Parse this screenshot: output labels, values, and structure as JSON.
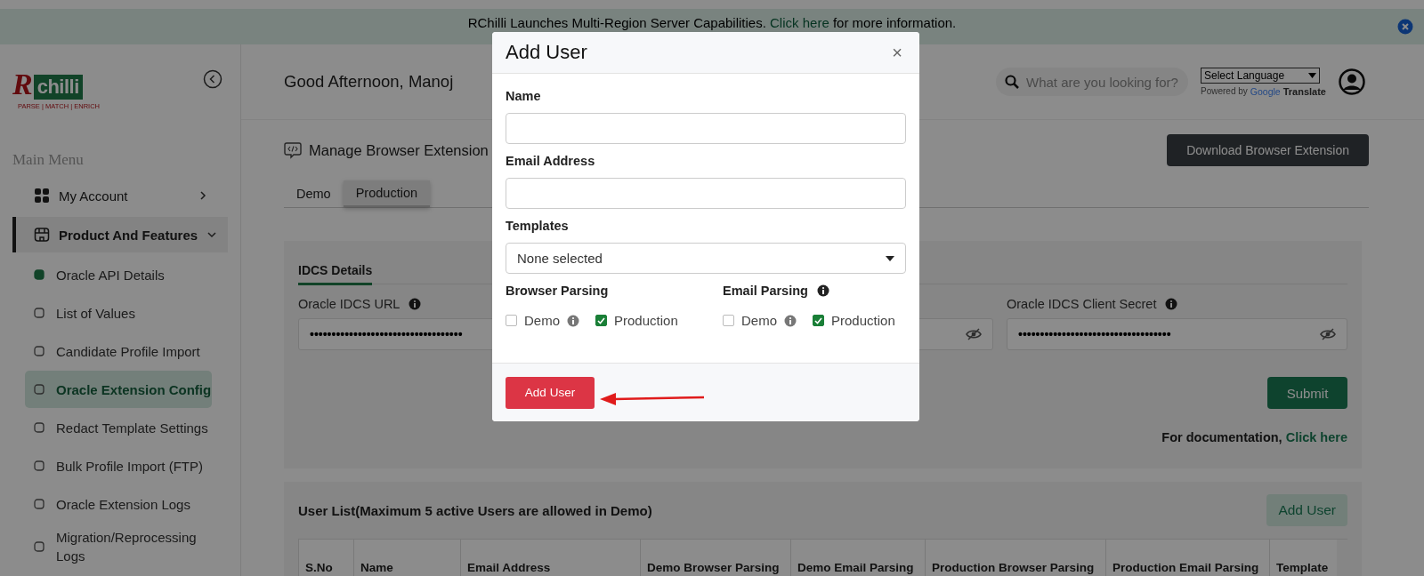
{
  "banner": {
    "before": "RChilli Launches Multi-Region Server Capabilities. ",
    "link": "Click here",
    "after": " for more information."
  },
  "logo": {
    "letter": "R",
    "word": "chilli",
    "tagline": "PARSE | MATCH | ENRICH"
  },
  "sidebar": {
    "heading": "Main Menu",
    "items": [
      {
        "kind": "group",
        "label": "My Account",
        "selected": false,
        "expanded": false
      },
      {
        "kind": "group",
        "label": "Product And Features",
        "selected": true,
        "expanded": true,
        "children": [
          {
            "label": "Oracle API Details",
            "selected": false
          },
          {
            "label": "List of Values",
            "selected": false
          },
          {
            "label": "Candidate Profile Import",
            "selected": false
          },
          {
            "label": "Oracle Extension Config",
            "selected": true
          },
          {
            "label": "Redact Template Settings",
            "selected": false
          },
          {
            "label": "Bulk Profile Import (FTP)",
            "selected": false
          },
          {
            "label": "Oracle Extension Logs",
            "selected": false
          },
          {
            "label": "Migration/Reprocessing Logs",
            "selected": false
          }
        ]
      }
    ]
  },
  "header": {
    "greeting": "Good Afternoon, Manoj",
    "search_placeholder": "What are you looking for?",
    "language": "Select Language",
    "powered_by": "Powered by",
    "google": "Google",
    "translate": "Translate"
  },
  "page": {
    "title": "Manage Browser Extension",
    "download_button": "Download Browser Extension",
    "tabs": [
      {
        "label": "Demo",
        "selected": false
      },
      {
        "label": "Production",
        "selected": true
      }
    ],
    "section_tab": "IDCS Details",
    "fields": [
      {
        "kind": "masked",
        "label": "Oracle IDCS URL",
        "value": "•••••••••••••••••••••••••••••••••••"
      },
      {
        "kind": "masked"
      },
      {
        "kind": "masked",
        "label": "Oracle IDCS Client Secret",
        "value": "•••••••••••••••••••••••••••••••••••"
      }
    ],
    "submit": "Submit",
    "doc_text": "For documentation, ",
    "doc_link": "Click here"
  },
  "user_list": {
    "title": "User List(Maximum 5 active Users are allowed in Demo)",
    "add_button": "Add User",
    "columns": [
      "S.No",
      "Name",
      "Email Address",
      "Demo Browser Parsing",
      "Demo Email Parsing",
      "Production Browser Parsing",
      "Production Email Parsing",
      "Template"
    ]
  },
  "modal": {
    "title": "Add User",
    "close": "×",
    "fields": [
      {
        "kind": "input",
        "label": "Name"
      },
      {
        "kind": "input",
        "label": "Email Address"
      },
      {
        "kind": "select",
        "label": "Templates",
        "value": "None selected"
      }
    ],
    "groups": [
      {
        "title": "Browser Parsing",
        "info": false,
        "options": [
          {
            "label": "Demo",
            "checked": false,
            "info": true
          },
          {
            "label": "Production",
            "checked": true,
            "info": false
          }
        ]
      },
      {
        "title": "Email Parsing",
        "info": true,
        "options": [
          {
            "label": "Demo",
            "checked": false,
            "info": true
          },
          {
            "label": "Production",
            "checked": true,
            "info": false
          }
        ]
      }
    ],
    "submit": "Add User"
  }
}
